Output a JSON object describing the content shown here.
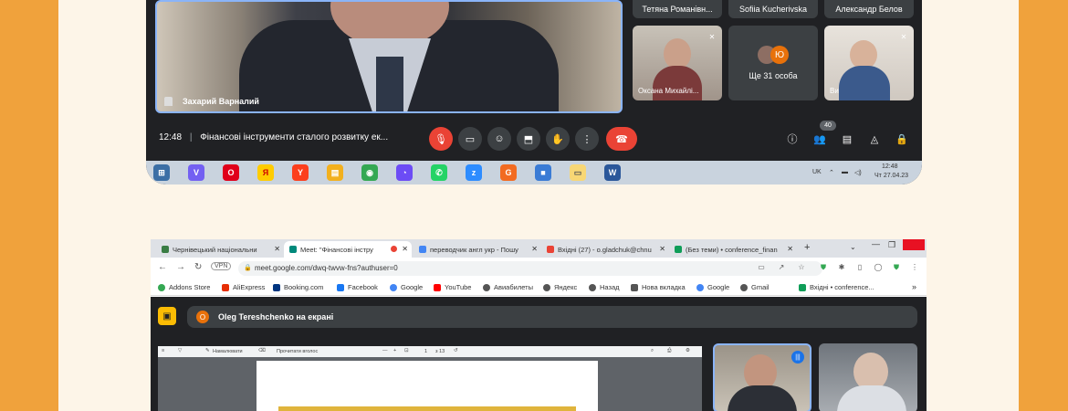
{
  "meeting_top": {
    "main_speaker": "Захарий Варналий",
    "top_names": [
      "Тетяна Романівн...",
      "Sofiia Kucherivska",
      "Александр Белов"
    ],
    "tiles": [
      {
        "name": "Оксана Михайлі..."
      },
      {
        "avatar_letter": "Ю",
        "label": "Ще 31 особа"
      },
      {
        "name": "Ви"
      }
    ],
    "time": "12:48",
    "separator": "|",
    "title": "Фінансові інструменти сталого розвитку ек...",
    "participants_count": "40",
    "controls": [
      "mic-off",
      "camera",
      "emoji",
      "present",
      "raise-hand",
      "more",
      "hang-up"
    ],
    "right_controls": [
      "info",
      "people",
      "chat",
      "activities",
      "host-controls"
    ]
  },
  "taskbar": {
    "lang": "UK",
    "clock_time": "12:48",
    "clock_date": "Чт 27.04.23",
    "apps": [
      {
        "name": "start",
        "color": "#3b6ea5",
        "glyph": "⊞"
      },
      {
        "name": "viber",
        "color": "#7360f2",
        "glyph": "V"
      },
      {
        "name": "opera",
        "color": "#e0001a",
        "glyph": "O"
      },
      {
        "name": "yandex-browser",
        "color": "#ffcc00",
        "glyph": "Я"
      },
      {
        "name": "yandex",
        "color": "#fc3f1d",
        "glyph": "Y"
      },
      {
        "name": "notes",
        "color": "#f2b01e",
        "glyph": "▤"
      },
      {
        "name": "chrome",
        "color": "#34a853",
        "glyph": "◉"
      },
      {
        "name": "sync",
        "color": "#6c4cf5",
        "glyph": "◔"
      },
      {
        "name": "whatsapp",
        "color": "#25d366",
        "glyph": "✆"
      },
      {
        "name": "zoom",
        "color": "#2d8cff",
        "glyph": "z"
      },
      {
        "name": "app-g",
        "color": "#f26b21",
        "glyph": "G"
      },
      {
        "name": "3d-box",
        "color": "#3a7bd5",
        "glyph": "■"
      },
      {
        "name": "file-explorer",
        "color": "#f8d775",
        "glyph": "▭"
      },
      {
        "name": "word",
        "color": "#2b579a",
        "glyph": "W"
      }
    ]
  },
  "browser": {
    "tabs": [
      {
        "label": "Чернівецький національни",
        "color": "#3a7d44"
      },
      {
        "label": "Meet: \"Фінансові інстру",
        "color": "#00897b"
      },
      {
        "label": "переводчик англ укр - Пошу",
        "color": "#4285f4"
      },
      {
        "label": "Вхідні (27) - o.gladchuk@chnu",
        "color": "#ea4335"
      },
      {
        "label": "(Без теми) • conference_finan",
        "color": "#0f9d58"
      }
    ],
    "new_tab": "+",
    "vpn": "VPN",
    "url": "meet.google.com/dwq-twvw-fns?authuser=0",
    "bookmarks": [
      {
        "label": "Addons Store",
        "color": "#34a853"
      },
      {
        "label": "AliExpress",
        "color": "#e62e04"
      },
      {
        "label": "Booking.com",
        "color": "#003580"
      },
      {
        "label": "Facebook",
        "color": "#1877f2"
      },
      {
        "label": "Google",
        "color": "#4285f4"
      },
      {
        "label": "YouTube",
        "color": "#ff0000"
      },
      {
        "label": "Авиабилеты",
        "color": "#555555"
      },
      {
        "label": "Яндекс",
        "color": "#555555"
      },
      {
        "label": "Назад",
        "color": "#555555"
      },
      {
        "label": "Нова вкладка",
        "color": "#555555"
      },
      {
        "label": "Google",
        "color": "#4285f4"
      },
      {
        "label": "Gmail",
        "color": "#555555"
      },
      {
        "label": "Вхідні • conference...",
        "color": "#0f9d58"
      }
    ],
    "more_bookmarks": "»"
  },
  "meeting_bottom": {
    "presenter_initial": "O",
    "presenter_text": "Oleg Tereshchenko на екрані",
    "doc_toolbar_text": "Намалювати",
    "doc_toolbar_text2": "Прочитати вголос",
    "doc_page": "1",
    "doc_pages": "з 13"
  }
}
